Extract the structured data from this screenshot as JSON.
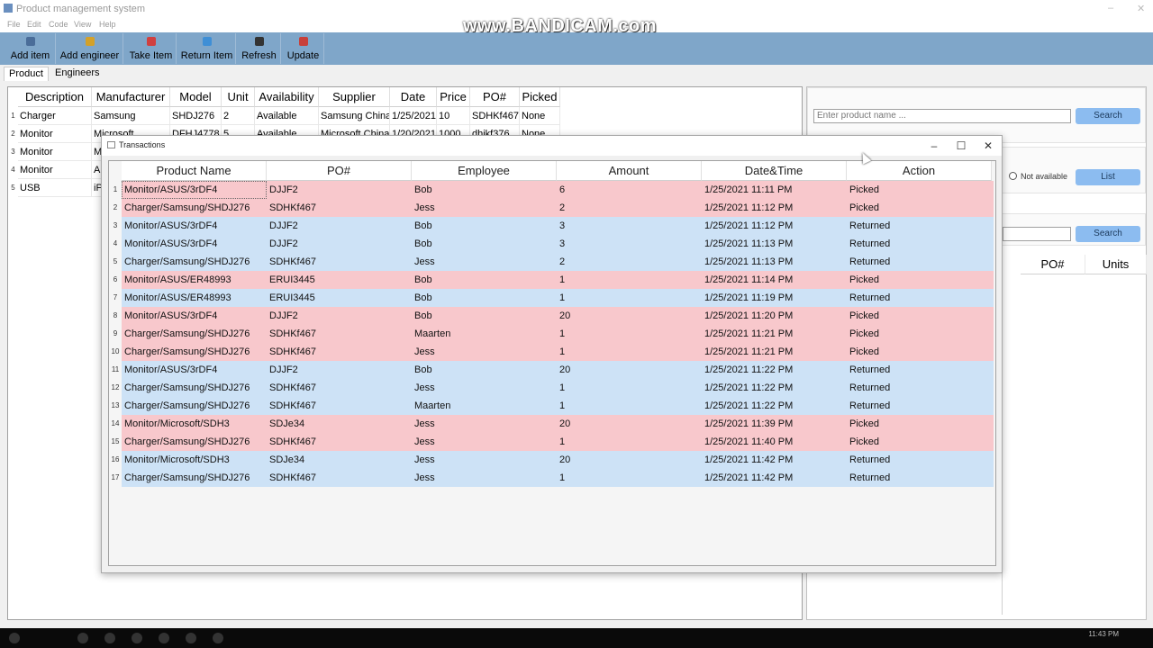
{
  "window": {
    "title": "Product management system"
  },
  "menu": [
    "File",
    "Edit",
    "Code",
    "View",
    "Help"
  ],
  "toolbar": [
    {
      "label": "Add item",
      "icon": "add-item-icon"
    },
    {
      "label": "Add engineer",
      "icon": "add-engineer-icon"
    },
    {
      "label": "Take Item",
      "icon": "take-item-icon"
    },
    {
      "label": "Return Item",
      "icon": "return-item-icon"
    },
    {
      "label": "Refresh",
      "icon": "refresh-icon"
    },
    {
      "label": "Update",
      "icon": "update-icon"
    }
  ],
  "tabs": [
    "Product",
    "Engineers"
  ],
  "product_grid": {
    "columns": [
      "Description",
      "Manufacturer",
      "Model",
      "Unit",
      "Availability",
      "Supplier",
      "Date",
      "Price",
      "PO#",
      "Picked"
    ],
    "rows": [
      [
        "Charger",
        "Samsung",
        "SHDJ276",
        "2",
        "Available",
        "Samsung China",
        "1/25/2021",
        "10",
        "SDHKf467",
        "None"
      ],
      [
        "Monitor",
        "Microsoft",
        "DFHJ4778",
        "5",
        "Available",
        "Microsoft China",
        "1/20/2021",
        "1000",
        "dhjkf376",
        "None"
      ],
      [
        "Monitor",
        "Mic",
        "",
        "",
        "",
        "",
        "",
        "",
        "",
        ""
      ],
      [
        "Monitor",
        "ASU",
        "",
        "",
        "",
        "",
        "",
        "",
        "",
        ""
      ],
      [
        "USB",
        "iPho",
        "",
        "",
        "",
        "",
        "",
        "",
        "",
        ""
      ]
    ],
    "row_numbers": [
      "1",
      "2",
      "3",
      "4",
      "5"
    ]
  },
  "right_panel": {
    "search_placeholder": "Enter product name ...",
    "search_label": "Search",
    "not_available_label": "Not available",
    "list_label": "List",
    "search2_label": "Search",
    "table_columns": [
      "PO#",
      "Units"
    ]
  },
  "dialog": {
    "title": "Transactions",
    "columns": [
      "Product Name",
      "PO#",
      "Employee",
      "Amount",
      "Date&Time",
      "Action"
    ],
    "rows": [
      {
        "n": "1",
        "product": "Monitor/ASUS/3rDF4",
        "po": "DJJF2",
        "employee": "Bob",
        "amount": "6",
        "datetime": "1/25/2021 11:11 PM",
        "action": "Picked"
      },
      {
        "n": "2",
        "product": "Charger/Samsung/SHDJ276",
        "po": "SDHKf467",
        "employee": "Jess",
        "amount": "2",
        "datetime": "1/25/2021 11:12 PM",
        "action": "Picked"
      },
      {
        "n": "3",
        "product": "Monitor/ASUS/3rDF4",
        "po": "DJJF2",
        "employee": "Bob",
        "amount": "3",
        "datetime": "1/25/2021 11:12 PM",
        "action": "Returned"
      },
      {
        "n": "4",
        "product": "Monitor/ASUS/3rDF4",
        "po": "DJJF2",
        "employee": "Bob",
        "amount": "3",
        "datetime": "1/25/2021 11:13 PM",
        "action": "Returned"
      },
      {
        "n": "5",
        "product": "Charger/Samsung/SHDJ276",
        "po": "SDHKf467",
        "employee": "Jess",
        "amount": "2",
        "datetime": "1/25/2021 11:13 PM",
        "action": "Returned"
      },
      {
        "n": "6",
        "product": "Monitor/ASUS/ER48993",
        "po": "ERUI3445",
        "employee": "Bob",
        "amount": "1",
        "datetime": "1/25/2021 11:14 PM",
        "action": "Picked"
      },
      {
        "n": "7",
        "product": "Monitor/ASUS/ER48993",
        "po": "ERUI3445",
        "employee": "Bob",
        "amount": "1",
        "datetime": "1/25/2021 11:19 PM",
        "action": "Returned"
      },
      {
        "n": "8",
        "product": "Monitor/ASUS/3rDF4",
        "po": "DJJF2",
        "employee": "Bob",
        "amount": "20",
        "datetime": "1/25/2021 11:20 PM",
        "action": "Picked"
      },
      {
        "n": "9",
        "product": "Charger/Samsung/SHDJ276",
        "po": "SDHKf467",
        "employee": "Maarten",
        "amount": "1",
        "datetime": "1/25/2021 11:21 PM",
        "action": "Picked"
      },
      {
        "n": "10",
        "product": "Charger/Samsung/SHDJ276",
        "po": "SDHKf467",
        "employee": "Jess",
        "amount": "1",
        "datetime": "1/25/2021 11:21 PM",
        "action": "Picked"
      },
      {
        "n": "11",
        "product": "Monitor/ASUS/3rDF4",
        "po": "DJJF2",
        "employee": "Bob",
        "amount": "20",
        "datetime": "1/25/2021 11:22 PM",
        "action": "Returned"
      },
      {
        "n": "12",
        "product": "Charger/Samsung/SHDJ276",
        "po": "SDHKf467",
        "employee": "Jess",
        "amount": "1",
        "datetime": "1/25/2021 11:22 PM",
        "action": "Returned"
      },
      {
        "n": "13",
        "product": "Charger/Samsung/SHDJ276",
        "po": "SDHKf467",
        "employee": "Maarten",
        "amount": "1",
        "datetime": "1/25/2021 11:22 PM",
        "action": "Returned"
      },
      {
        "n": "14",
        "product": "Monitor/Microsoft/SDH3",
        "po": "SDJe34",
        "employee": "Jess",
        "amount": "20",
        "datetime": "1/25/2021 11:39 PM",
        "action": "Picked"
      },
      {
        "n": "15",
        "product": "Charger/Samsung/SHDJ276",
        "po": "SDHKf467",
        "employee": "Jess",
        "amount": "1",
        "datetime": "1/25/2021 11:40 PM",
        "action": "Picked"
      },
      {
        "n": "16",
        "product": "Monitor/Microsoft/SDH3",
        "po": "SDJe34",
        "employee": "Jess",
        "amount": "20",
        "datetime": "1/25/2021 11:42 PM",
        "action": "Returned"
      },
      {
        "n": "17",
        "product": "Charger/Samsung/SHDJ276",
        "po": "SDHKf467",
        "employee": "Jess",
        "amount": "1",
        "datetime": "1/25/2021 11:42 PM",
        "action": "Returned"
      }
    ]
  },
  "colors": {
    "picked": "#f8c8cc",
    "returned": "#cde2f6",
    "toolbar": "#7fa6c9",
    "button": "#8cbcf0"
  },
  "watermark": "www.BANDICAM.com",
  "clock": "11:43 PM"
}
